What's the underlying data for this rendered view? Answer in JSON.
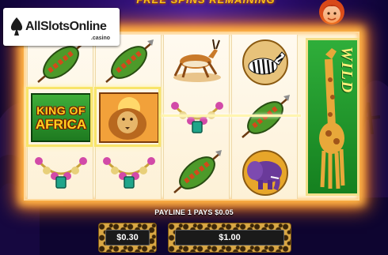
{
  "header": {
    "banner_text": "FREE SPINS REMAINING"
  },
  "logo": {
    "name": "AllSlotsOnline",
    "suffix": ".casino"
  },
  "reels": {
    "reel1": [
      "shield",
      "king-of-africa",
      "necklace"
    ],
    "reel2": [
      "shield",
      "lion",
      "necklace"
    ],
    "reel3": [
      "antelope",
      "necklace",
      "shield"
    ],
    "reel4": [
      "zebra",
      "shield",
      "elephant"
    ],
    "reel5": [
      "giraffe-wild"
    ]
  },
  "symbols": {
    "king_of_africa_line1": "KING OF",
    "king_of_africa_line2": "AFRICA",
    "wild": "WILD"
  },
  "status": {
    "payline_text": "PAYLINE 1 PAYS $0.05"
  },
  "bet": {
    "line_bet": "$0.30",
    "total_bet": "$1.00"
  },
  "colors": {
    "glow": "#ff7a1a",
    "highlight": "#f8e46a",
    "wild_green": "#2fae3a"
  }
}
